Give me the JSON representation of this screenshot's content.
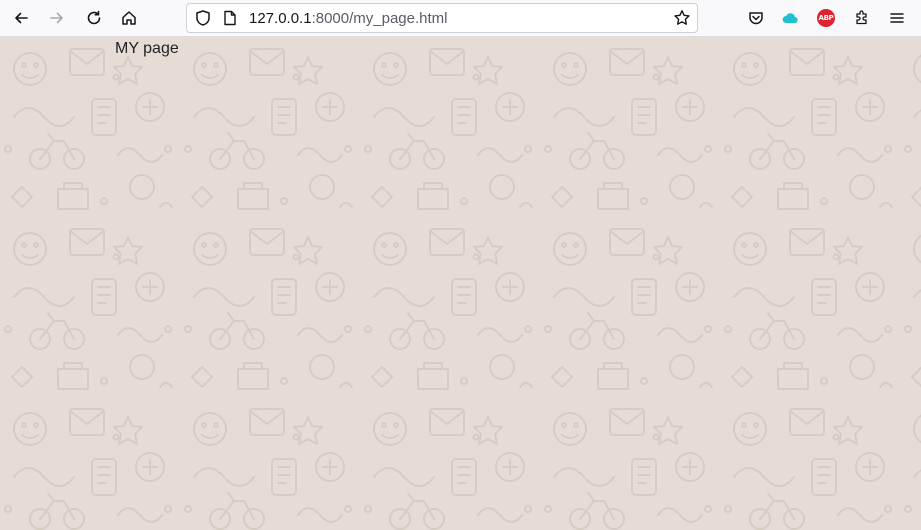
{
  "browser": {
    "url_host": "127.0.0.1",
    "url_path": ":8000/my_page.html",
    "colors": {
      "toolbar_bg": "#f9f9fb",
      "accent_cloud": "#20c0d0",
      "abp_red": "#e0212e"
    },
    "icons": [
      "back-icon",
      "forward-icon",
      "reload-icon",
      "home-icon",
      "shield-icon",
      "page-icon",
      "bookmark-star-icon",
      "pocket-icon",
      "cloud-icon",
      "adblock-icon",
      "extensions-icon",
      "menu-icon"
    ],
    "abp_label": "ABP"
  },
  "page": {
    "heading": "MY page",
    "background_color": "#e5ddd5"
  }
}
